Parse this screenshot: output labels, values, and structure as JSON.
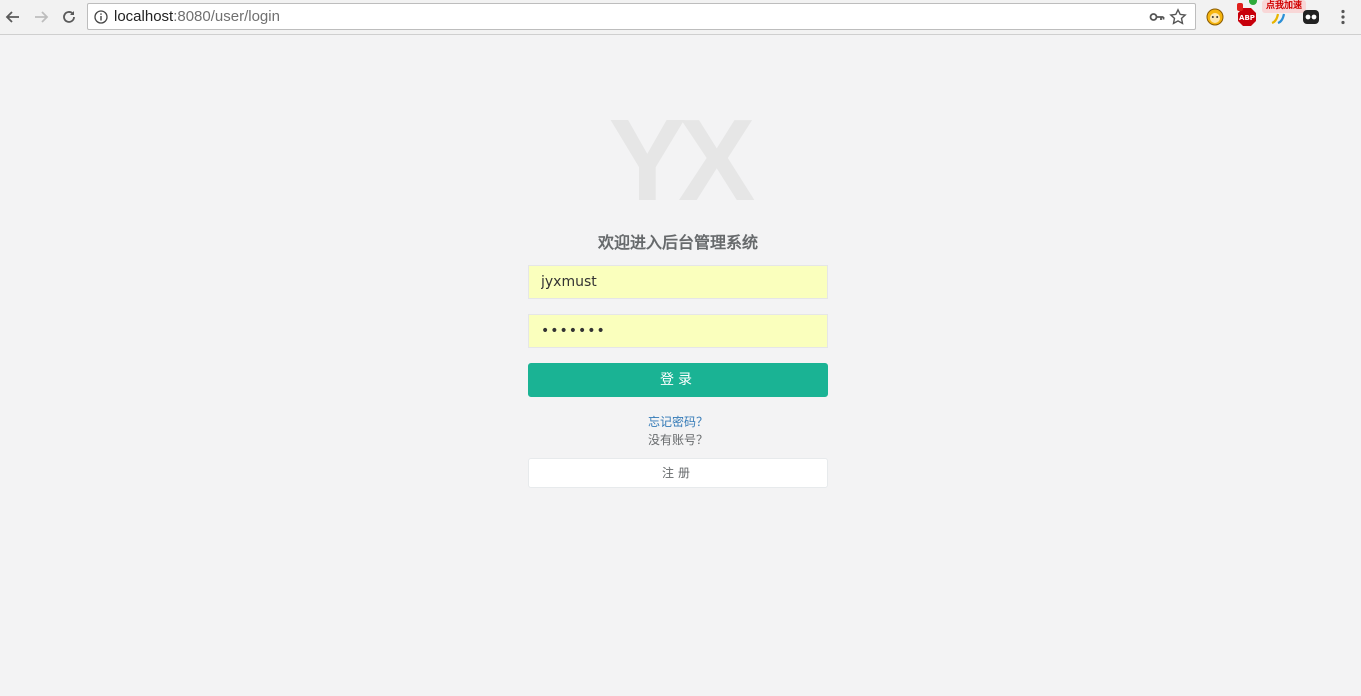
{
  "browser": {
    "url_host": "localhost",
    "url_path": ":8080/user/login",
    "icons": {
      "back": "back-arrow-icon",
      "forward": "forward-arrow-icon",
      "reload": "reload-icon",
      "info": "info-icon",
      "key": "key-icon",
      "star": "bookmark-star-icon",
      "menu": "kebab-menu-icon"
    },
    "extensions": {
      "badge_text": "点我加速"
    }
  },
  "login": {
    "logo": "YX",
    "welcome": "欢迎进入后台管理系统",
    "username_value": "jyxmust",
    "password_masked": "•••••••",
    "login_button": "登录",
    "forgot_link": "忘记密码？",
    "no_account_text": "没有账号？",
    "register_button": "注册"
  },
  "colors": {
    "page_bg": "#f3f3f4",
    "primary": "#1ab394",
    "autofill": "#faffbd",
    "link": "#337ab7",
    "text": "#676a6c"
  }
}
